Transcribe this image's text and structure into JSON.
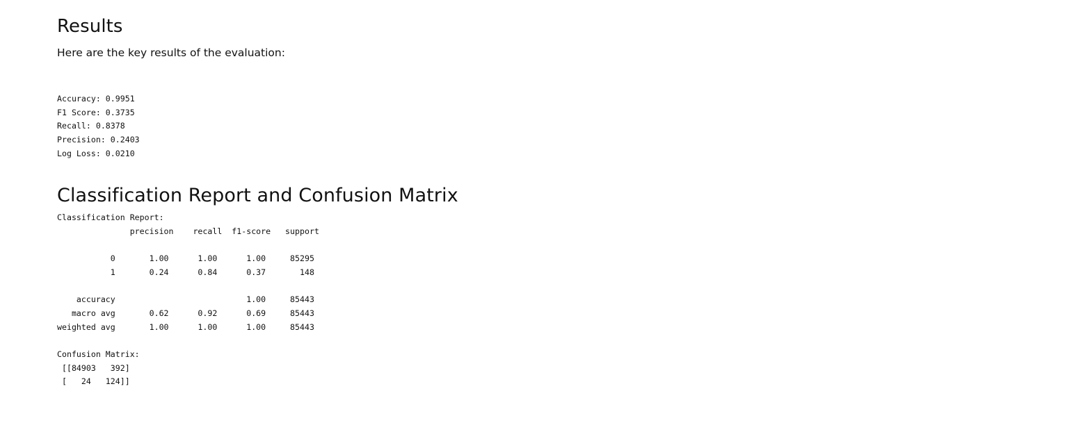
{
  "results": {
    "heading": "Results",
    "intro": "Here are the key results of the evaluation:",
    "metrics": [
      "Accuracy: 0.9951",
      "F1 Score: 0.3735",
      "Recall: 0.8378",
      "Precision: 0.2403",
      "Log Loss: 0.0210"
    ]
  },
  "report": {
    "heading": "Classification Report and Confusion Matrix",
    "lines": [
      "Classification Report:",
      "               precision    recall  f1-score   support",
      "",
      "           0       1.00      1.00      1.00     85295",
      "           1       0.24      0.84      0.37       148",
      "",
      "    accuracy                           1.00     85443",
      "   macro avg       0.62      0.92      0.69     85443",
      "weighted avg       1.00      1.00      1.00     85443",
      "",
      "Confusion Matrix:",
      " [[84903   392]",
      " [   24   124]]"
    ]
  }
}
